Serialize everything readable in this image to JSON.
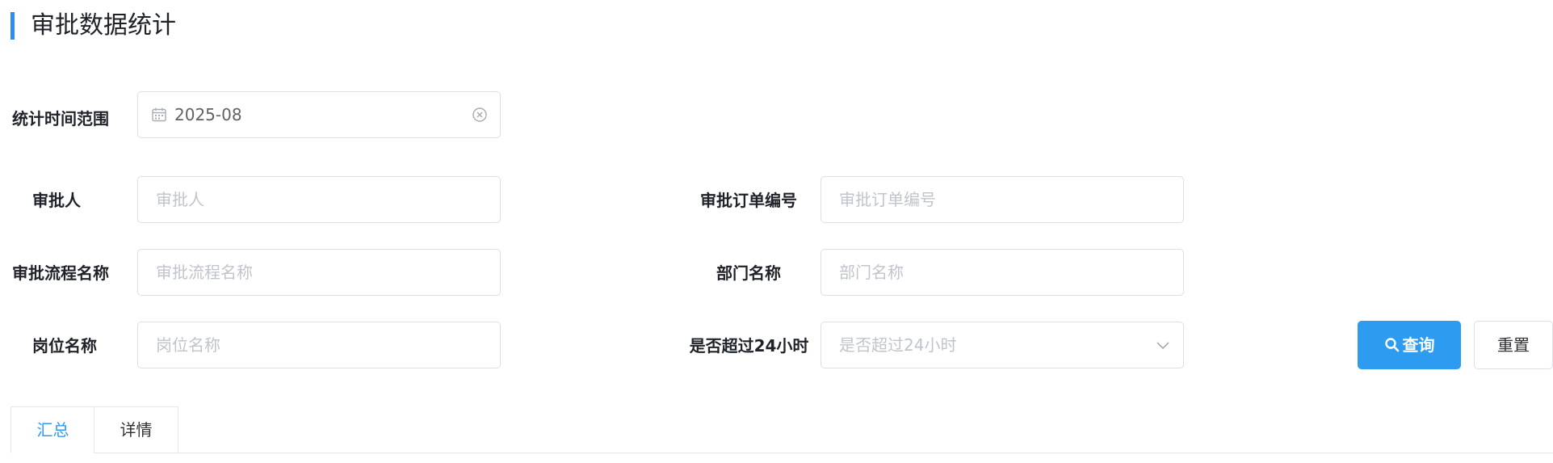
{
  "page": {
    "title": "审批数据统计"
  },
  "filters": {
    "date_range": {
      "label": "统计时间范围",
      "value": "2025-08"
    },
    "approver": {
      "label": "审批人",
      "placeholder": "审批人"
    },
    "order_no": {
      "label": "审批订单编号",
      "placeholder": "审批订单编号"
    },
    "flow_name": {
      "label": "审批流程名称",
      "placeholder": "审批流程名称"
    },
    "dept_name": {
      "label": "部门名称",
      "placeholder": "部门名称"
    },
    "post_name": {
      "label": "岗位名称",
      "placeholder": "岗位名称"
    },
    "over_24h": {
      "label": "是否超过24小时",
      "placeholder": "是否超过24小时"
    }
  },
  "actions": {
    "query_label": "查询",
    "reset_label": "重置"
  },
  "tabs": [
    {
      "label": "汇总",
      "active": true
    },
    {
      "label": "详情",
      "active": false
    }
  ],
  "colors": {
    "accent": "#2d9bf0",
    "border": "#dcdfe6",
    "placeholder": "#c0c4cc"
  },
  "icons": {
    "date": "calendar-icon",
    "clear": "clear-circle-icon",
    "select": "chevron-down-icon",
    "query": "search-icon"
  }
}
